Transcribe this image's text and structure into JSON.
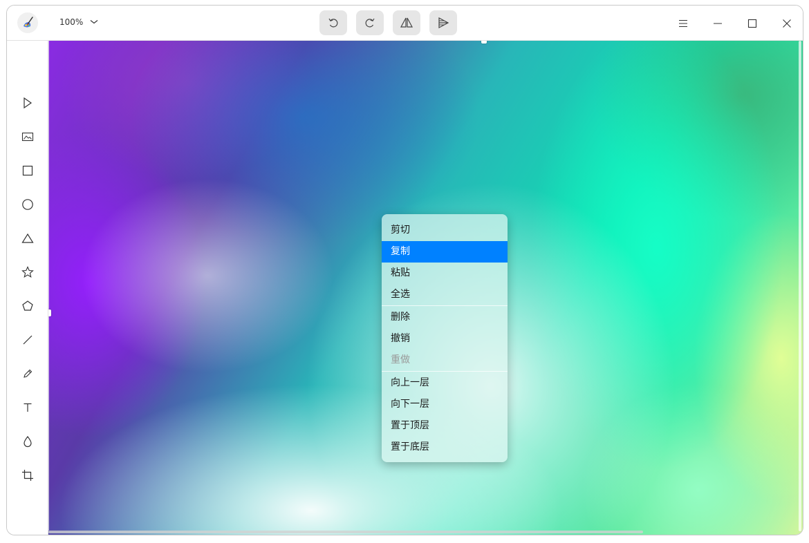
{
  "titlebar": {
    "app_icon": "brush-palette-icon",
    "zoom_label": "100%",
    "buttons": [
      {
        "name": "undo-button",
        "icon": "undo-icon"
      },
      {
        "name": "redo-button",
        "icon": "redo-icon"
      },
      {
        "name": "flip-horizontal-button",
        "icon": "flip-horizontal-icon"
      },
      {
        "name": "flip-vertical-button",
        "icon": "flip-vertical-icon"
      }
    ],
    "window_controls": [
      "menu-icon",
      "minimize-icon",
      "maximize-icon",
      "close-icon"
    ]
  },
  "tools": [
    "select-tool",
    "image-tool",
    "rectangle-tool",
    "ellipse-tool",
    "triangle-tool",
    "star-tool",
    "polygon-tool",
    "line-tool",
    "pencil-tool",
    "text-tool",
    "blur-tool",
    "crop-tool"
  ],
  "context_menu": {
    "groups": [
      [
        {
          "label": "剪切",
          "state": "normal"
        },
        {
          "label": "复制",
          "state": "active"
        },
        {
          "label": "粘贴",
          "state": "normal"
        },
        {
          "label": "全选",
          "state": "normal"
        }
      ],
      [
        {
          "label": "删除",
          "state": "normal"
        },
        {
          "label": "撤销",
          "state": "normal"
        },
        {
          "label": "重做",
          "state": "disabled"
        }
      ],
      [
        {
          "label": "向上一层",
          "state": "normal"
        },
        {
          "label": "向下一层",
          "state": "normal"
        },
        {
          "label": "置于顶层",
          "state": "normal"
        },
        {
          "label": "置于底层",
          "state": "normal"
        }
      ]
    ]
  },
  "colors": {
    "accent": "#0081ff",
    "toolbar_button_bg": "#e6e6e6",
    "icon_stroke": "#333333"
  }
}
